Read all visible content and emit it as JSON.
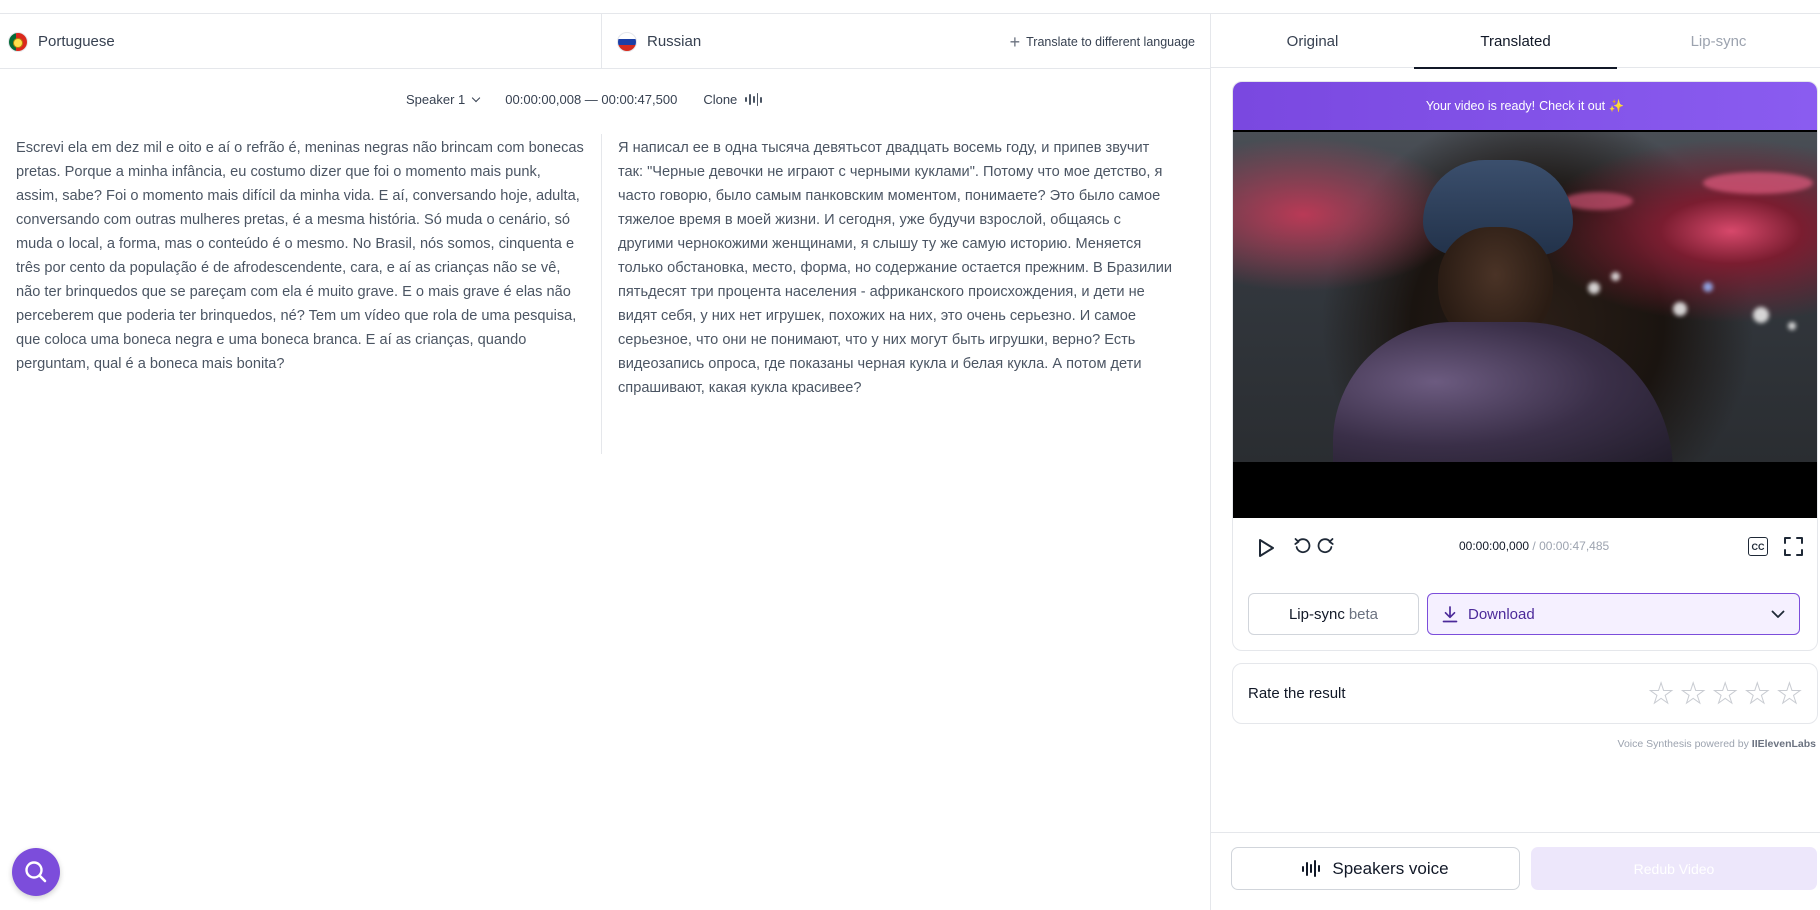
{
  "editor": {
    "source_language": "Portuguese",
    "target_language": "Russian",
    "translate_link": "Translate to different language",
    "speaker": "Speaker 1",
    "timecode": "00:00:00,008 — 00:00:47,500",
    "clone_label": "Clone",
    "source_text": "Escrevi ela em dez mil e oito e aí o refrão é, meninas negras não brincam com bonecas pretas. Porque a minha infância, eu costumo dizer que foi o momento mais punk, assim, sabe? Foi o momento mais difícil da minha vida. E aí, conversando hoje, adulta, conversando com outras mulheres pretas, é a mesma história. Só muda o cenário, só muda o local, a forma, mas o conteúdo é o mesmo. No Brasil, nós somos, cinquenta e três por cento da população é de afrodescendente, cara, e aí as crianças não se vê, não ter brinquedos que se pareçam com ela é muito grave. E o mais grave é elas não perceberem que poderia ter brinquedos, né? Tem um vídeo que rola de uma pesquisa, que coloca uma boneca negra e uma boneca branca. E aí as crianças, quando perguntam, qual é a boneca mais bonita?",
    "target_text": "Я написал ее в одна тысяча девятьсот двадцать восемь году, и припев звучит так: \"Черные девочки не играют с черными куклами\". Потому что мое детство, я часто говорю, было самым панковским моментом, понимаете? Это было самое тяжелое время в моей жизни. И сегодня, уже будучи взрослой, общаясь с другими чернокожими женщинами, я слышу ту же самую историю. Меняется только обстановка, место, форма, но содержание остается прежним. В Бразилии пятьдесят три процента населения - африканского происхождения, и дети не видят себя, у них нет игрушек, похожих на них, это очень серьезно. И самое серьезное, что они не понимают, что у них могут быть игрушки, верно? Есть видеозапись опроса, где показаны черная кукла и белая кукла. А потом дети спрашивают, какая кукла красивее?"
  },
  "panel": {
    "tabs": [
      {
        "label": "Original"
      },
      {
        "label": "Translated"
      },
      {
        "label": "Lip-sync"
      }
    ],
    "active_tab": "Translated",
    "banner": {
      "text": "Your video is ready!",
      "cta": "Check it out ✨"
    },
    "player": {
      "current_time": "00:00:00,000",
      "separator": "/",
      "duration": "00:00:47,485",
      "cc_label": "CC"
    },
    "lipsync_button": {
      "label": "Lip-sync",
      "badge": "beta"
    },
    "download_button": {
      "label": "Download"
    },
    "rating": {
      "label": "Rate the result",
      "max_stars": 5,
      "value": 0
    },
    "powered_by": {
      "prefix": "Voice Synthesis powered by",
      "brand": "IIElevenLabs"
    },
    "speakers_button": "Speakers voice",
    "redub_button": "Redub Video"
  },
  "colors": {
    "accent": "#7c4ddb",
    "banner": "#7a48e0",
    "redub_disabled": "#ede7fb"
  },
  "icons": [
    "portugal-flag-icon",
    "russia-flag-icon",
    "plus-icon",
    "chevron-down-icon",
    "waveform-icon",
    "play-icon",
    "rewind-icon",
    "forward-icon",
    "cc-icon",
    "fullscreen-icon",
    "download-icon",
    "star-icon",
    "search-icon"
  ]
}
